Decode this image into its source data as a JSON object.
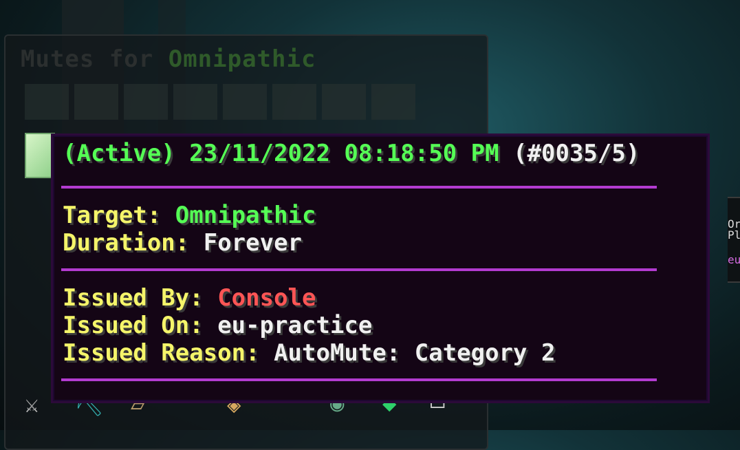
{
  "window": {
    "title_prefix": "Mutes for",
    "title_name": "Omnipathic"
  },
  "tooltip": {
    "header_status": "(Active)",
    "header_datetime": "23/11/2022 08:18:50 PM",
    "header_id": "(#0035/5)",
    "target_label": "Target:",
    "target_value": "Omnipathic",
    "duration_label": "Duration:",
    "duration_value": "Forever",
    "issued_by_label": "Issued By:",
    "issued_by_value": "Console",
    "issued_on_label": "Issued On:",
    "issued_on_value": "eu-practice",
    "issued_reason_label": "Issued Reason:",
    "issued_reason_value": "AutoMute: Category 2"
  },
  "side_panel": {
    "line1": "Or",
    "line2": "Pl",
    "line3": "eu"
  },
  "colors": {
    "active_green": "#55ff55",
    "label_yellow": "#f5f56a",
    "console_red": "#ff5555",
    "separator_magenta": "#b33bd0"
  }
}
